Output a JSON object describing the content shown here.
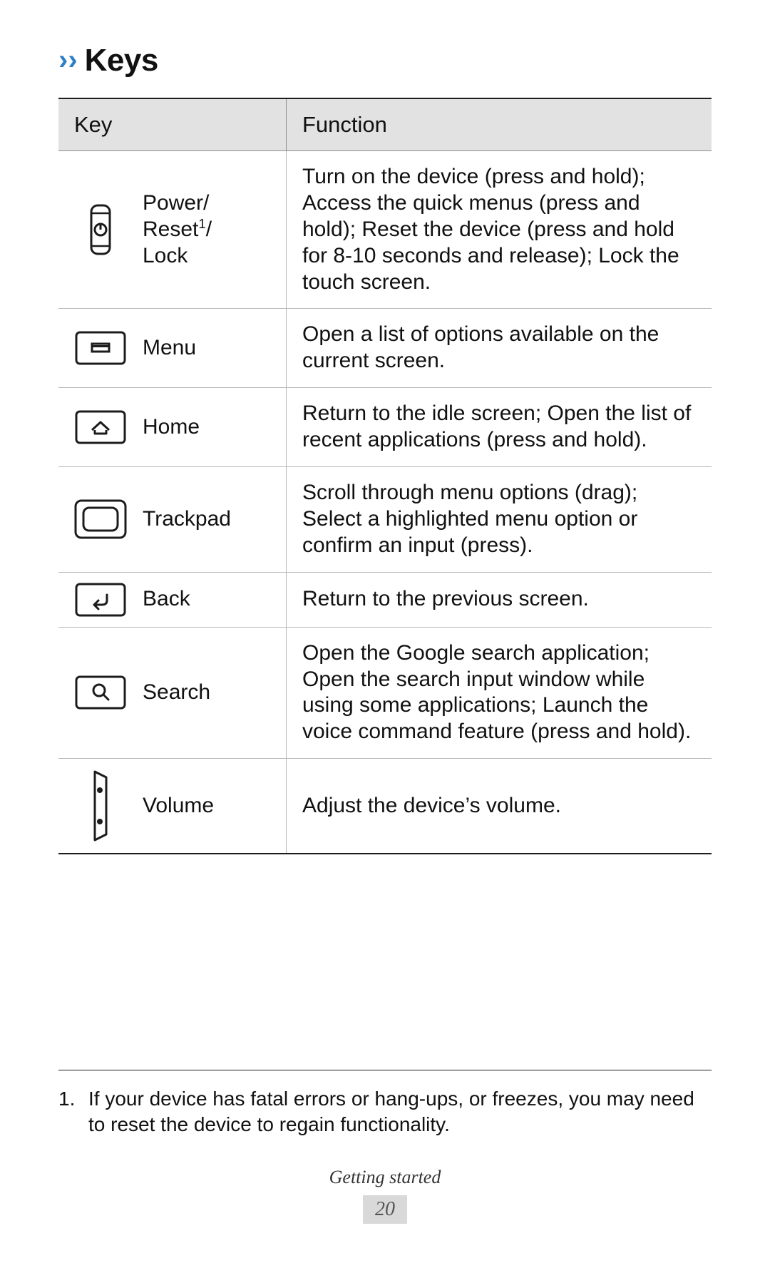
{
  "heading": {
    "chevron": "››",
    "title": "Keys"
  },
  "table": {
    "columns": [
      "Key",
      "Function"
    ],
    "rows": [
      {
        "icon": "power-key-icon",
        "key": "Power/\nReset1/\nLock",
        "key_html": "Power/<br>Reset<sup>1</sup>/<br>Lock",
        "function": "Turn on the device (press and hold); Access the quick menus (press and hold); Reset the device (press and hold for 8-10 seconds and release); Lock the touch screen."
      },
      {
        "icon": "menu-key-icon",
        "key": "Menu",
        "function": "Open a list of options available on the current screen."
      },
      {
        "icon": "home-key-icon",
        "key": "Home",
        "function": "Return to the idle screen; Open the list of recent applications (press and hold)."
      },
      {
        "icon": "trackpad-key-icon",
        "key": "Trackpad",
        "function": "Scroll through menu options (drag); Select a highlighted menu option or confirm an input (press)."
      },
      {
        "icon": "back-key-icon",
        "key": "Back",
        "function": "Return to the previous screen."
      },
      {
        "icon": "search-key-icon",
        "key": "Search",
        "function": "Open the Google search application; Open the search input window while using some applications; Launch the voice command feature (press and hold)."
      },
      {
        "icon": "volume-key-icon",
        "key": "Volume",
        "function": "Adjust the device’s volume."
      }
    ]
  },
  "footnote": {
    "number": "1.",
    "text": "If your device has fatal errors or hang-ups, or freezes, you may need to reset the device to regain functionality."
  },
  "footer": {
    "section": "Getting started",
    "page": "20"
  },
  "colors": {
    "accent": "#2e7fc9",
    "header_bg": "#e2e2e2",
    "rule": "#1c1c1c",
    "page_badge_bg": "#d9d9d9"
  }
}
